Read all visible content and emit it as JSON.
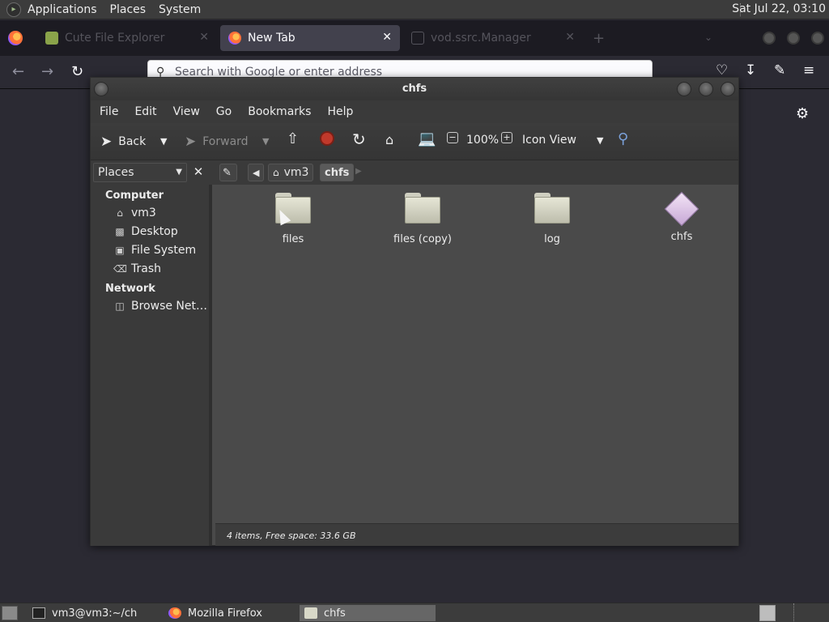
{
  "top_panel": {
    "menus": [
      "Applications",
      "Places",
      "System"
    ],
    "clock": "Sat Jul 22, 03:10"
  },
  "firefox": {
    "tabs": [
      {
        "label": "Cute File Explorer",
        "state": "inactive"
      },
      {
        "label": "New Tab",
        "state": "active"
      },
      {
        "label": "vod.ssrc.Manager",
        "state": "inactive"
      }
    ],
    "url_placeholder": "Search with Google or enter address"
  },
  "caja": {
    "title": "chfs",
    "menu": [
      "File",
      "Edit",
      "View",
      "Go",
      "Bookmarks",
      "Help"
    ],
    "toolbar": {
      "back": "Back",
      "forward": "Forward",
      "zoom": "100%",
      "view_mode": "Icon View"
    },
    "sidebar_combo": "Places",
    "breadcrumbs": [
      "vm3",
      "chfs"
    ],
    "sidebar": {
      "computer_header": "Computer",
      "computer_items": [
        "vm3",
        "Desktop",
        "File System",
        "Trash"
      ],
      "network_header": "Network",
      "network_items": [
        "Browse Net…"
      ]
    },
    "files": [
      {
        "name": "files",
        "kind": "folder"
      },
      {
        "name": "files (copy)",
        "kind": "folder"
      },
      {
        "name": "log",
        "kind": "folder"
      },
      {
        "name": "chfs",
        "kind": "executable"
      }
    ],
    "status": "4 items, Free space: 33.6 GB"
  },
  "taskbar": {
    "items": [
      {
        "label": "vm3@vm3:~/ch",
        "state": "inactive"
      },
      {
        "label": "Mozilla Firefox",
        "state": "inactive"
      },
      {
        "label": "chfs",
        "state": "active"
      }
    ]
  }
}
